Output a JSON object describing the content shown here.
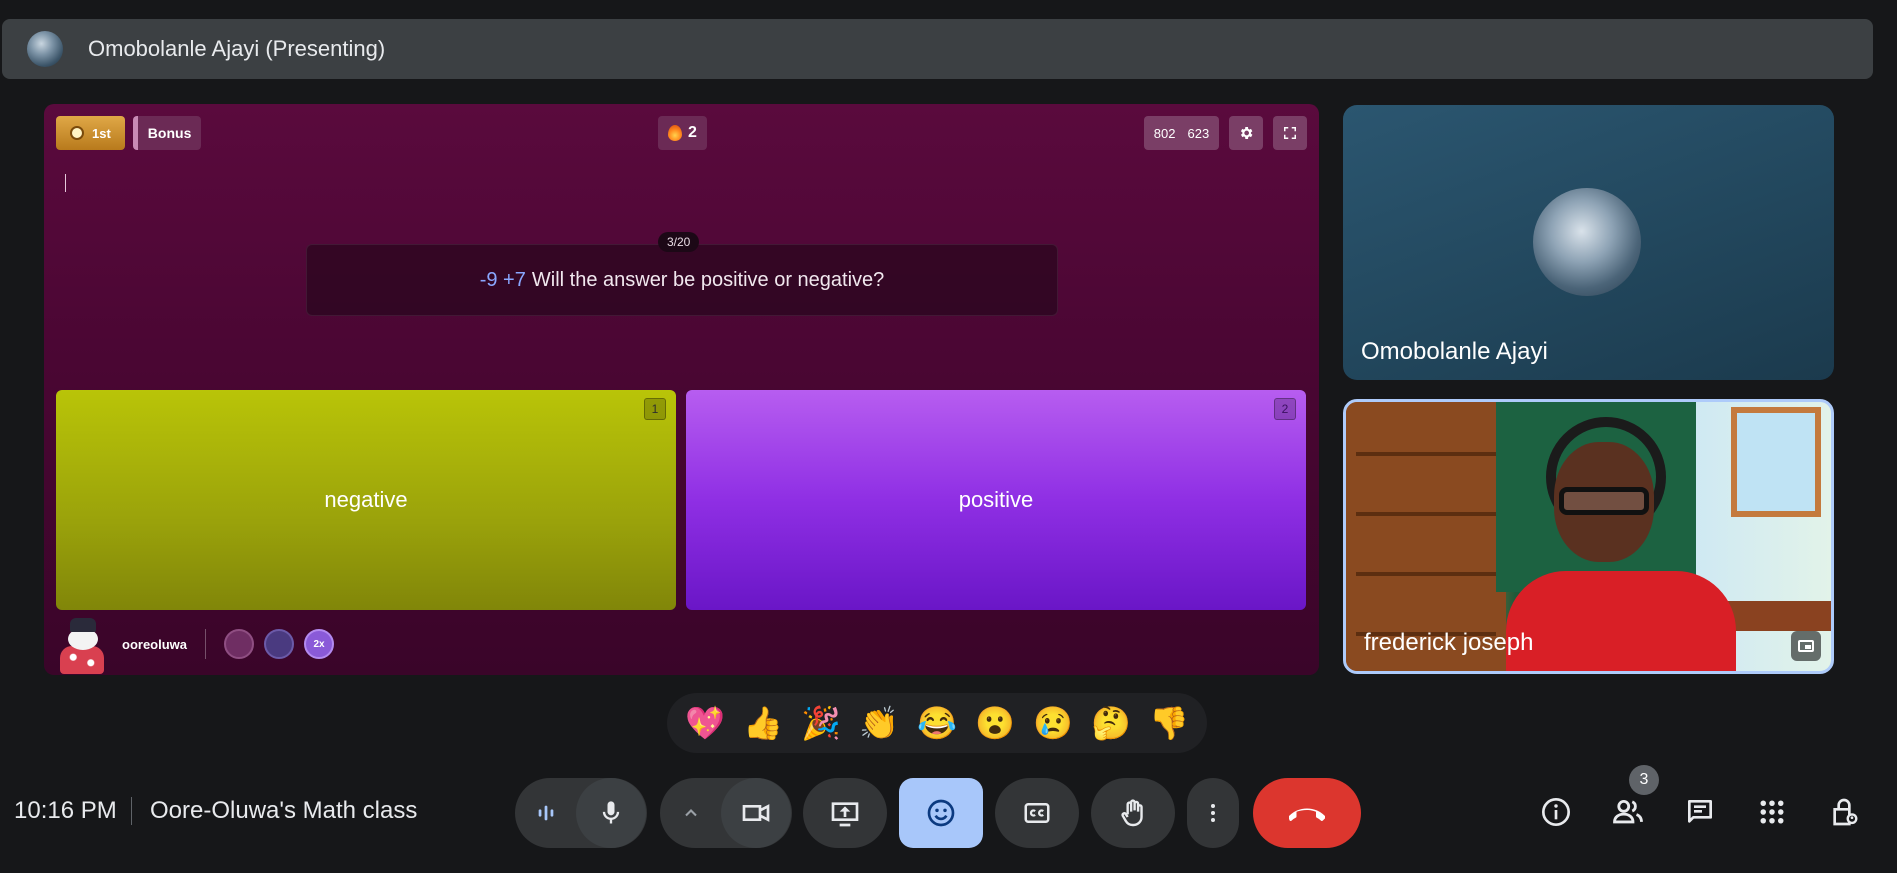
{
  "presenter_bar": {
    "title": "Omobolanle Ajayi (Presenting)"
  },
  "game": {
    "rank_label": "1st",
    "bonus_label": "Bonus",
    "streak_count": "2",
    "score_a": "802",
    "score_b": "623",
    "question_counter": "3/20",
    "question_numbers": "-9 +7",
    "question_text": "Will the answer be positive or negative?",
    "answers": [
      {
        "number": "1",
        "label": "negative",
        "color": "#a6b10a"
      },
      {
        "number": "2",
        "label": "positive",
        "color": "#9b3fe6"
      }
    ],
    "player_name": "ooreoluwa",
    "powerup_3_label": "2x"
  },
  "participants": [
    {
      "name": "Omobolanle Ajayi"
    },
    {
      "name": "frederick joseph"
    }
  ],
  "reactions": [
    "💖",
    "👍",
    "🎉",
    "👏",
    "😂",
    "😮",
    "😢",
    "🤔",
    "👎"
  ],
  "bottom_bar": {
    "time": "10:16 PM",
    "meeting_title": "Oore-Oluwa's Math class",
    "people_count": "3"
  },
  "colors": {
    "leave": "#dc362e",
    "emoji_active": "#a8c7fa",
    "active_speaker_border": "#aecbfa"
  }
}
